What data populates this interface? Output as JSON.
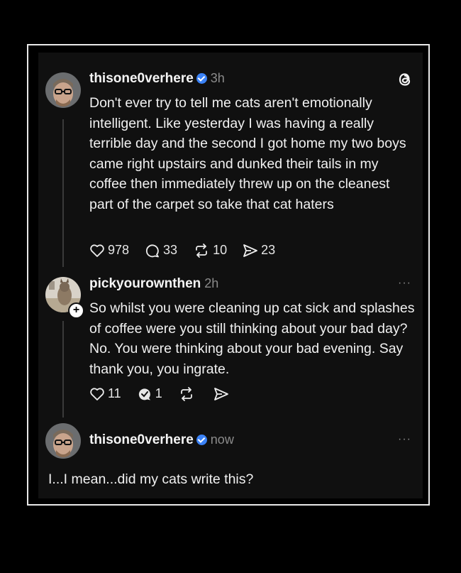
{
  "post1": {
    "username": "thisone0verhere",
    "time": "3h",
    "text": "Don't ever try to tell me cats aren't emotionally intelligent. Like yesterday I was having a really terrible day and the second I got home my two boys came right upstairs and dunked their tails in my coffee then immediately threw up on the cleanest part of the carpet so take that cat haters",
    "likes": "978",
    "comments": "33",
    "reposts": "10",
    "shares": "23"
  },
  "post2": {
    "username": "pickyourownthen",
    "time": "2h",
    "text": "So whilst you were cleaning up cat sick and splashes of coffee were you still thinking about your bad day? No. You were thinking about your bad evening. Say thank you, you ingrate.",
    "likes": "11",
    "comments": "1",
    "more": "···"
  },
  "post3": {
    "username": "thisone0verhere",
    "time": "now",
    "more": "···"
  },
  "reply": {
    "text": "I...I mean...did my cats write this?"
  },
  "colors": {
    "verified": "#3b82f6",
    "background": "#101010",
    "muted": "#8b8b8b"
  },
  "icons": [
    "threads-logo-icon",
    "verified-icon",
    "heart-icon",
    "comment-icon",
    "repost-icon",
    "share-icon",
    "plus-icon",
    "more-icon"
  ]
}
